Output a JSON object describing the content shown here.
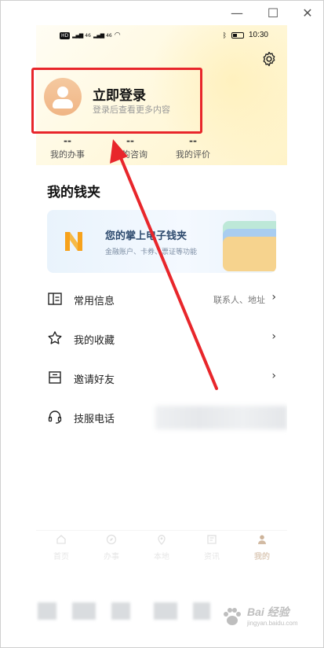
{
  "window": {
    "minimize_glyph": "—",
    "maximize_glyph": "☐",
    "close_glyph": "✕"
  },
  "status_bar": {
    "hd_label": "HD",
    "signal1": "46",
    "signal2": "46",
    "time": "10:30"
  },
  "profile": {
    "login_title": "立即登录",
    "login_subtitle": "登录后查看更多内容"
  },
  "stats": [
    {
      "value": "--",
      "label": "我的办事"
    },
    {
      "value": "--",
      "label": "我的咨询"
    },
    {
      "value": "--",
      "label": "我的评价"
    }
  ],
  "wallet": {
    "section_title": "我的钱夹",
    "banner_title": "您的掌上电子钱夹",
    "banner_subtitle": "金融账户、卡券、票证等功能"
  },
  "menu": [
    {
      "label": "常用信息",
      "extra": "联系人、地址",
      "icon": "id-card-icon"
    },
    {
      "label": "我的收藏",
      "extra": "",
      "icon": "star-icon"
    },
    {
      "label": "邀请好友",
      "extra": "",
      "icon": "invite-icon"
    },
    {
      "label": "技服电话",
      "extra": "",
      "icon": "headset-icon"
    }
  ],
  "tabbar": [
    {
      "label": "首页",
      "icon": "home-icon"
    },
    {
      "label": "办事",
      "icon": "compass-icon"
    },
    {
      "label": "本地",
      "icon": "location-icon"
    },
    {
      "label": "资讯",
      "icon": "news-icon"
    },
    {
      "label": "我的",
      "icon": "profile-icon",
      "active": true
    }
  ],
  "watermark": {
    "text": "Bai 经验",
    "url": "jingyan.baidu.com"
  },
  "colors": {
    "highlight_red": "#e8262b",
    "accent_brown": "#a87b4e",
    "wallet_logo_orange": "#f7a21b"
  }
}
